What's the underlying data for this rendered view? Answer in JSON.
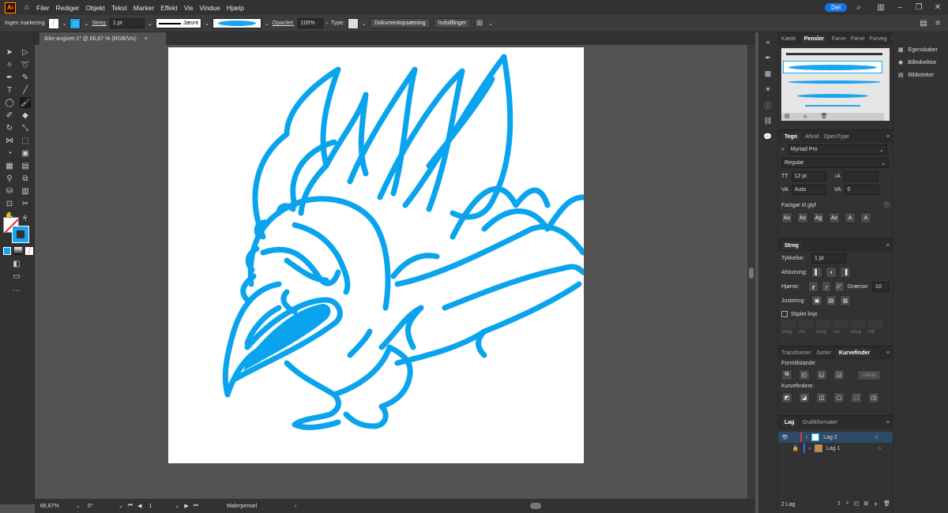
{
  "menubar": {
    "logo": "Ai",
    "items": [
      "Filer",
      "Rediger",
      "Objekt",
      "Tekst",
      "Marker",
      "Effekt",
      "Vis",
      "Vindue",
      "Hjælp"
    ],
    "share": "Del"
  },
  "control": {
    "selection": "Ingen markering",
    "stroke_label": "Streg:",
    "stroke_value": "1 pt",
    "profile": "Jævnt",
    "opacity_label": "Opacitet:",
    "opacity_value": "100%",
    "type_label": "Type:",
    "doc_setup": "Dokumentopsætning",
    "prefs": "Indstillinger"
  },
  "document": {
    "tab": "Ikke-angivet-1* @ 66,67 % (RGB/Vis)",
    "close": "×"
  },
  "status": {
    "zoom": "66,67%",
    "rotate": "0°",
    "page": "1",
    "tool": "Malerpensel"
  },
  "brushes": {
    "tabs": [
      "Kæde",
      "Pensler",
      "Farve",
      "Farve",
      "Farveg"
    ],
    "active": "Pensler",
    "brush_color": "#1ba5ef"
  },
  "character": {
    "tabs": [
      "Tegn",
      "Afsnit",
      "OpenType"
    ],
    "font": "Myriad Pro",
    "style": "Regular",
    "size": "12 pt",
    "leading": "",
    "kerning": "Auto",
    "tracking": "0",
    "snap_label": "Fastgør til glyf"
  },
  "stroke": {
    "title": "Streg",
    "weight_label": "Tykkelse:",
    "weight": "1 pt",
    "cap_label": "Afslutning:",
    "corner_label": "Hjørne:",
    "limit_label": "Grænse:",
    "limit": "10",
    "align_label": "Justering:",
    "dashed": "Stiplet linje",
    "dash_labels": [
      "streg",
      "mlr",
      "streg",
      "mlr",
      "streg",
      "mlr"
    ]
  },
  "pathfinder": {
    "tabs": [
      "Transformer",
      "Juster",
      "Kurvefinder"
    ],
    "shape_modes": "Formtilstande:",
    "expand": "Udvid",
    "pathfinders": "Kurvefindere:"
  },
  "layers": {
    "tabs": [
      "Lag",
      "Grafikformater"
    ],
    "items": [
      {
        "name": "Lag 2",
        "color": "#e0303a"
      },
      {
        "name": "Lag 1",
        "color": "#3c6ff0"
      }
    ],
    "count": "2 Lag"
  },
  "rightcol": {
    "items": [
      "Egenskaber",
      "Billedvektor",
      "Biblioteker"
    ]
  },
  "art": {
    "color": "#0aa4ee"
  }
}
